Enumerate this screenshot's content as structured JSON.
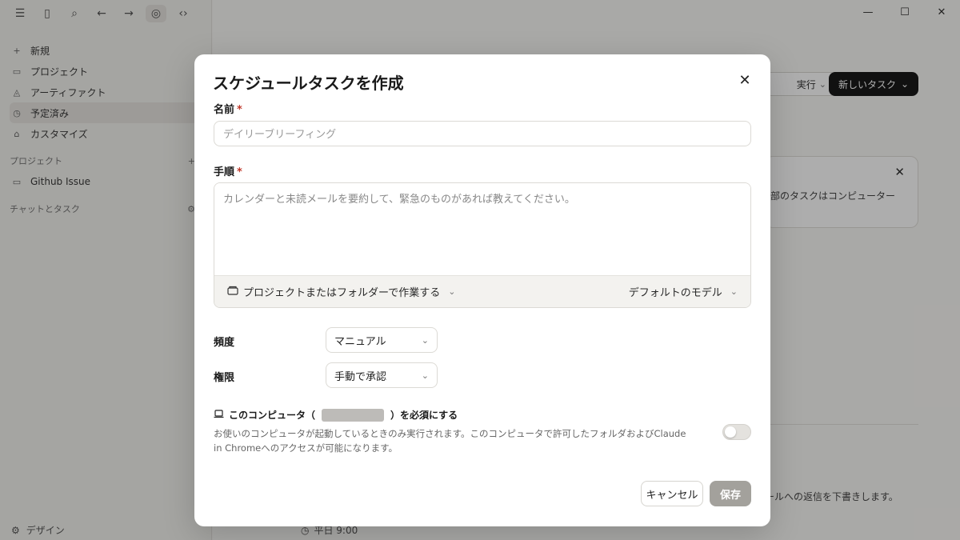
{
  "background": {
    "sidebar": {
      "items": [
        {
          "label": "新規",
          "icon": "plus-icon"
        },
        {
          "label": "プロジェクト",
          "icon": "folder-icon"
        },
        {
          "label": "アーティファクト",
          "icon": "artifact-icon"
        },
        {
          "label": "予定済み",
          "icon": "clock-icon"
        },
        {
          "label": "カスタマイズ",
          "icon": "toolbox-icon"
        }
      ],
      "projects_heading": "プロジェクト",
      "project_item": "Github Issue",
      "chats_heading": "チャットとタスク",
      "bottom_item": "デザイン"
    },
    "main": {
      "run_button": "実行",
      "new_task_button": "新しいタスク",
      "card_text": "部のタスクはコンピューター",
      "footer_text": "ールへの返信を下書きします。",
      "bottom_row": "平日 9:00"
    }
  },
  "modal": {
    "title": "スケジュールタスクを作成",
    "name": {
      "label": "名前",
      "required_mark": "*",
      "value": "",
      "placeholder": "デイリーブリーフィング"
    },
    "steps": {
      "label": "手順",
      "required_mark": "*",
      "value": "",
      "placeholder": "カレンダーと未読メールを要約して、緊急のものがあれば教えてください。",
      "project_button": "プロジェクトまたはフォルダーで作業する",
      "model_button": "デフォルトのモデル"
    },
    "frequency": {
      "label": "頻度",
      "selected": "マニュアル"
    },
    "permission": {
      "label": "権限",
      "selected": "手動で承認"
    },
    "require_computer": {
      "prefix": "このコンピュータ（",
      "suffix": "）を必須にする",
      "description": "お使いのコンピュータが起動しているときのみ実行されます。このコンピュータで許可したフォルダおよびClaude in Chromeへのアクセスが可能になります。",
      "enabled": false
    },
    "cancel_button": "キャンセル",
    "save_button": "保存"
  }
}
